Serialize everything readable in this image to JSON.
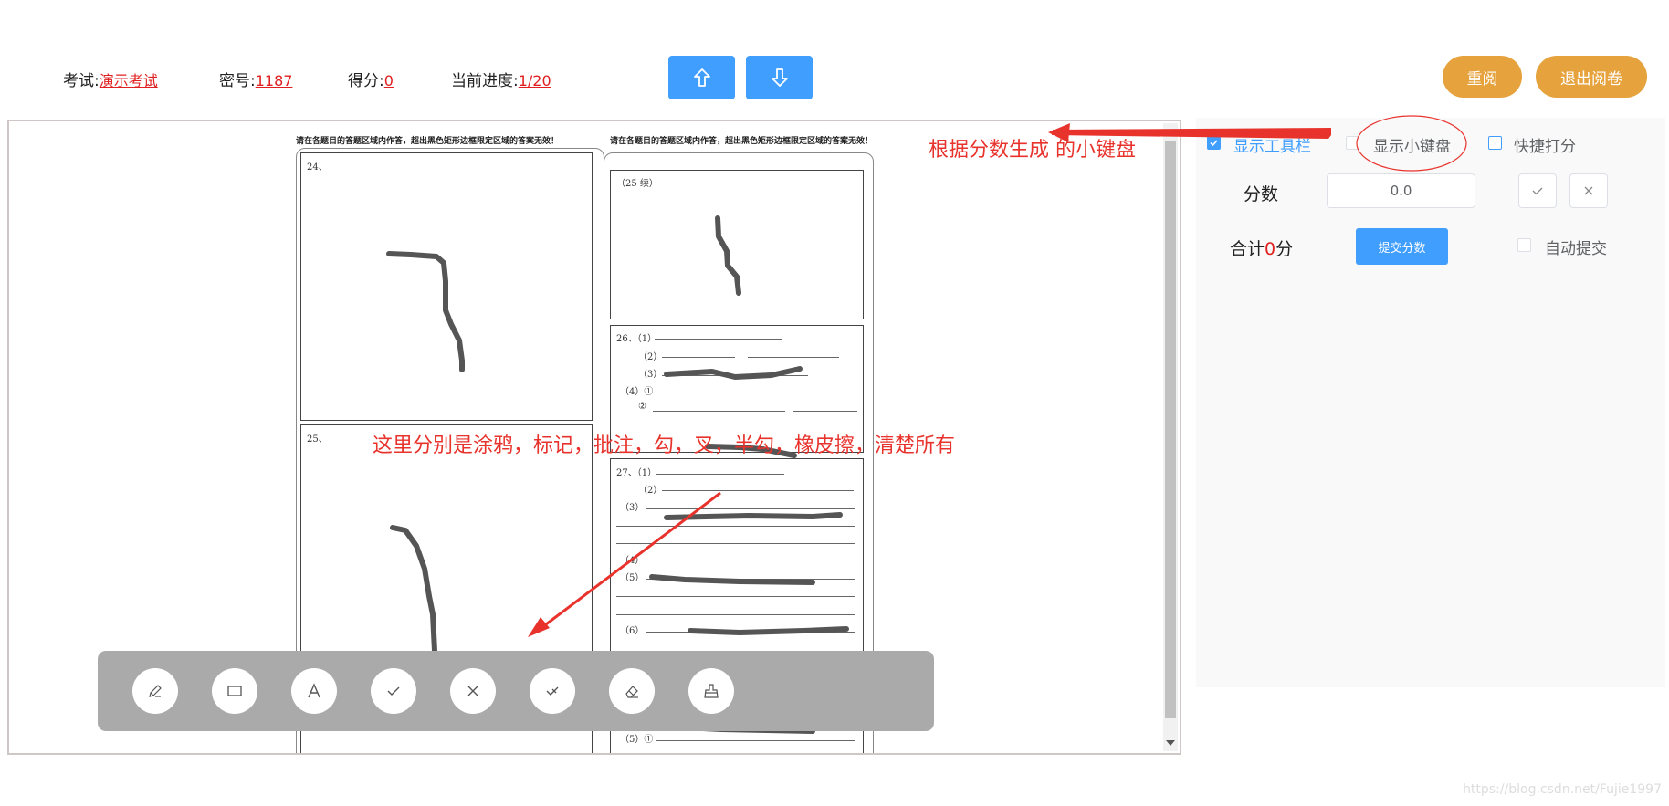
{
  "header": {
    "exam_label": "考试:",
    "exam_value": "演示考试",
    "secret_label": "密号:",
    "secret_value": "1187",
    "score_label": "得分:",
    "score_value": "0",
    "progress_label": "当前进度:",
    "progress_value": "1/20",
    "reread_label": "重阅",
    "exit_label": "退出阅卷"
  },
  "sheet": {
    "left_header": "请在各题目的答题区域内作答，超出黑色矩形边框限定区域的答案无效！",
    "right_header": "请在各题目的答题区域内作答，超出黑色矩形边框限定区域的答案无效！",
    "q24": "24、",
    "q25": "25、",
    "q25cont": "（25 续）",
    "q26_1": "26、（1）",
    "q26_2": "（2）",
    "q26_3": "（3）",
    "q26_4": "（4）①",
    "q26_4b": "②",
    "q27_1": "27、（1）",
    "q27_2": "（2）",
    "q27_3": "（3）",
    "q27_4": "（4）",
    "q27_5": "（5）",
    "q27_6": "（6）",
    "q_bottom": "（5）①"
  },
  "toolbar": {
    "tools": [
      "pencil-icon",
      "rectangle-icon",
      "text-icon",
      "check-icon",
      "cross-icon",
      "half-check-icon",
      "eraser-icon",
      "broom-icon"
    ]
  },
  "panel": {
    "show_toolbar": "显示工具栏",
    "show_keypad": "显示小键盘",
    "quick_score": "快捷打分",
    "score_label": "分数",
    "score_value": "0.0",
    "total_prefix": "合计",
    "total_value": "0",
    "total_suffix": "分",
    "submit_label": "提交分数",
    "auto_submit": "自动提交"
  },
  "annotations": {
    "keypad_note": "根据分数生成 的小键盘",
    "tools_note": "这里分别是涂鸦，标记，批注，勾，叉，半勾，橡皮擦，清楚所有"
  },
  "colors": {
    "primary": "#409eff",
    "warning": "#e6a23c",
    "annotation": "#e8332d",
    "toolbar_bg": "#aaaaaa"
  },
  "watermark": "https://blog.csdn.net/Fujie1997"
}
